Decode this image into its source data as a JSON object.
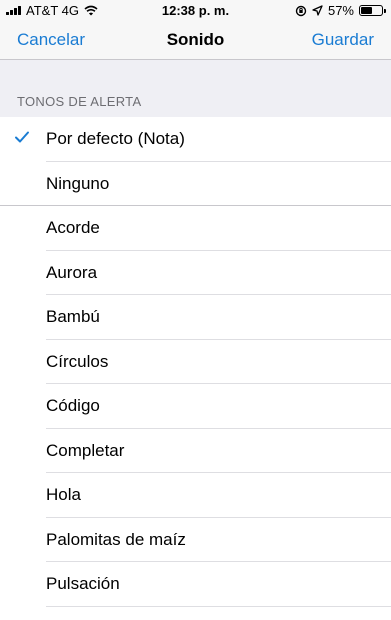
{
  "status_bar": {
    "carrier": "AT&T 4G",
    "time": "12:38 p. m.",
    "battery_percent": "57%",
    "battery_level": 0.57
  },
  "nav": {
    "left_label": "Cancelar",
    "title": "Sonido",
    "right_label": "Guardar",
    "accent_color": "#1a7cd3"
  },
  "section": {
    "header": "TONOS DE ALERTA"
  },
  "items": [
    {
      "label": "Por defecto (Nota)",
      "selected": true
    },
    {
      "label": "Ninguno",
      "selected": false
    },
    {
      "label": "Acorde",
      "selected": false
    },
    {
      "label": "Aurora",
      "selected": false
    },
    {
      "label": "Bambú",
      "selected": false
    },
    {
      "label": "Círculos",
      "selected": false
    },
    {
      "label": "Código",
      "selected": false
    },
    {
      "label": "Completar",
      "selected": false
    },
    {
      "label": "Hola",
      "selected": false
    },
    {
      "label": "Palomitas de maíz",
      "selected": false
    },
    {
      "label": "Pulsación",
      "selected": false
    }
  ]
}
